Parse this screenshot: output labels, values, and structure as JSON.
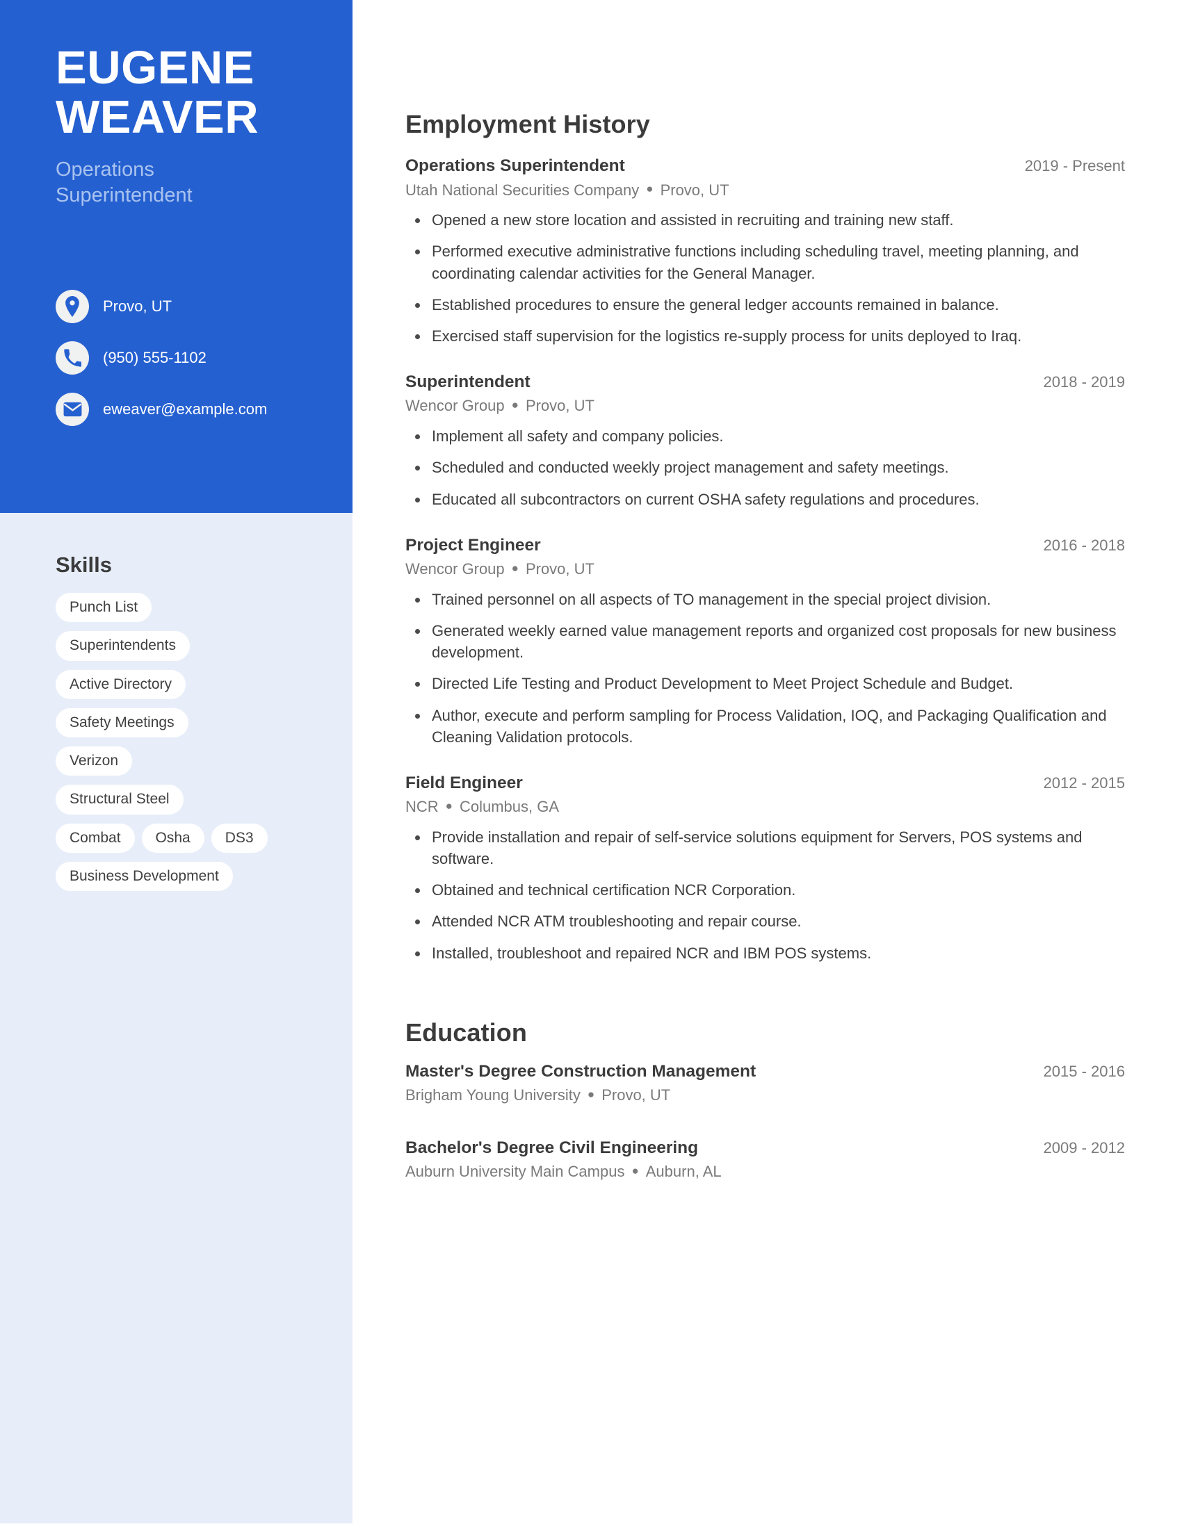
{
  "profile": {
    "first_name": "EUGENE",
    "last_name": "WEAVER",
    "headline_line1": "Operations",
    "headline_line2": "Superintendent",
    "accent_color": "#2560d0",
    "sidebar_color": "#e8eef9",
    "headline_color": "#a9c3ef"
  },
  "contacts": [
    {
      "icon": "location-pin-icon",
      "value": "Provo, UT"
    },
    {
      "icon": "phone-icon",
      "value": "(950) 555-1102"
    },
    {
      "icon": "envelope-icon",
      "value": "eweaver@example.com"
    }
  ],
  "skills": {
    "title": "Skills",
    "rows": [
      [
        "Punch List"
      ],
      [
        "Superintendents"
      ],
      [
        "Active Directory"
      ],
      [
        "Safety Meetings"
      ],
      [
        "Verizon"
      ],
      [
        "Structural Steel"
      ],
      [
        "Combat",
        "Osha",
        "DS3"
      ],
      [
        "Business Development"
      ]
    ]
  },
  "employment": {
    "title": "Employment History",
    "entries": [
      {
        "role": "Operations Superintendent",
        "dates": "2019 - Present",
        "company": "Utah National Securities Company",
        "location": "Provo, UT",
        "bullets": [
          "Opened a new store location and assisted in recruiting and training new staff.",
          "Performed executive administrative functions including scheduling travel, meeting planning, and coordinating calendar activities for the General Manager.",
          "Established procedures to ensure the general ledger accounts remained in balance.",
          "Exercised staff supervision for the logistics re-supply process for units deployed to Iraq."
        ]
      },
      {
        "role": "Superintendent",
        "dates": "2018 - 2019",
        "company": "Wencor Group",
        "location": "Provo, UT",
        "bullets": [
          "Implement all safety and company policies.",
          "Scheduled and conducted weekly project management and safety meetings.",
          "Educated all subcontractors on current OSHA safety regulations and procedures."
        ]
      },
      {
        "role": "Project Engineer",
        "dates": "2016 - 2018",
        "company": "Wencor Group",
        "location": "Provo, UT",
        "bullets": [
          "Trained personnel on all aspects of TO management in the special project division.",
          "Generated weekly earned value management reports and organized cost proposals for new business development.",
          "Directed Life Testing and Product Development to Meet Project Schedule and Budget.",
          "Author, execute and perform sampling for Process Validation, IOQ, and Packaging Qualification and Cleaning Validation protocols."
        ]
      },
      {
        "role": "Field Engineer",
        "dates": "2012 - 2015",
        "company": "NCR",
        "location": "Columbus, GA",
        "bullets": [
          "Provide installation and repair of self-service solutions equipment for Servers, POS systems and software.",
          "Obtained and technical certification NCR Corporation.",
          "Attended NCR ATM troubleshooting and repair course.",
          "Installed, troubleshoot and repaired NCR and IBM POS systems."
        ]
      }
    ]
  },
  "education": {
    "title": "Education",
    "entries": [
      {
        "degree": "Master's Degree Construction Management",
        "dates": "2015 - 2016",
        "school": "Brigham Young University",
        "location": "Provo, UT"
      },
      {
        "degree": "Bachelor's Degree Civil Engineering",
        "dates": "2009 - 2012",
        "school": "Auburn University Main Campus",
        "location": "Auburn, AL"
      }
    ]
  }
}
